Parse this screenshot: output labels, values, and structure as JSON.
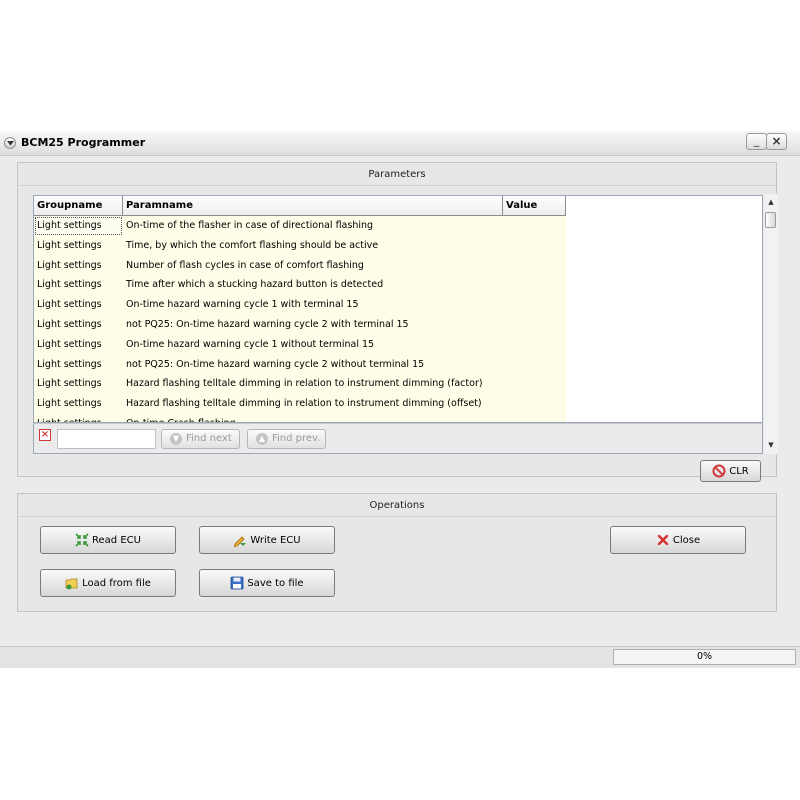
{
  "window": {
    "title": "BCM25 Programmer",
    "minimize_label": "_",
    "close_label": "×"
  },
  "parameters": {
    "title": "Parameters",
    "columns": [
      "Groupname",
      "Paramname",
      "Value"
    ],
    "rows": [
      {
        "group": "Light settings",
        "param": "On-time of the flasher in case of directional flashing",
        "value": ""
      },
      {
        "group": "Light settings",
        "param": "Time, by which the comfort flashing should be active",
        "value": ""
      },
      {
        "group": "Light settings",
        "param": "Number of flash cycles in case of comfort flashing",
        "value": ""
      },
      {
        "group": "Light settings",
        "param": "Time after which a stucking hazard button is detected",
        "value": ""
      },
      {
        "group": "Light settings",
        "param": "On-time hazard warning cycle 1 with terminal 15",
        "value": ""
      },
      {
        "group": "Light settings",
        "param": "not PQ25: On-time hazard warning cycle 2 with terminal 15",
        "value": ""
      },
      {
        "group": "Light settings",
        "param": "On-time hazard warning cycle 1 without terminal 15",
        "value": ""
      },
      {
        "group": "Light settings",
        "param": "not PQ25: On-time hazard warning cycle 2 without terminal 15",
        "value": ""
      },
      {
        "group": "Light settings",
        "param": "Hazard flashing telltale dimming in relation to instrument dimming (factor)",
        "value": ""
      },
      {
        "group": "Light settings",
        "param": "Hazard flashing telltale dimming in relation to instrument dimming (offset)",
        "value": ""
      },
      {
        "group": "Light settings",
        "param": "On-time Crash-flashing",
        "value": ""
      }
    ],
    "search": {
      "value": "",
      "find_next_label": "Find next",
      "find_prev_label": "Find prev."
    },
    "clr_label": "CLR"
  },
  "operations": {
    "title": "Operations",
    "read_label": "Read ECU",
    "write_label": "Write ECU",
    "close_label": "Close",
    "load_label": "Load from file",
    "save_label": "Save to file"
  },
  "status": {
    "progress_text": "0%",
    "progress_value": 0
  },
  "colors": {
    "row_bg": "#fdfde8",
    "grid_border": "#9aa8b8",
    "window_bg": "#ebebeb",
    "danger": "#d03a3a"
  }
}
